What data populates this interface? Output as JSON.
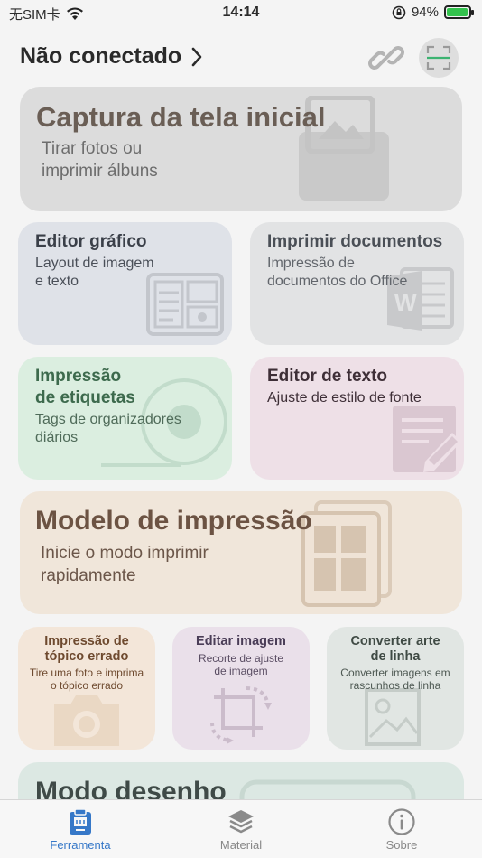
{
  "status": {
    "carrier": "无SIM卡",
    "time": "14:14",
    "battery": "94%"
  },
  "header": {
    "connection_label": "Não conectado",
    "chevron": ">"
  },
  "cards": {
    "home_capture": {
      "title": "Captura da tela inicial",
      "subtitle": "Tirar fotos ou\nimprimir álbuns"
    },
    "graphic_editor": {
      "title": "Editor gráfico",
      "subtitle": "Layout de imagem\ne texto"
    },
    "print_documents": {
      "title": "Imprimir documentos",
      "subtitle": "Impressão de\ndocumentos do Office"
    },
    "label_printing": {
      "title": "Impressão\nde etiquetas",
      "subtitle": "Tags de organizadores\ndiários"
    },
    "text_editor": {
      "title": "Editor de texto",
      "subtitle": "Ajuste de estilo de fonte"
    },
    "print_template": {
      "title": "Modelo de impressão",
      "subtitle": "Inicie o modo imprimir\nrapidamente"
    },
    "wrong_topic": {
      "title": "Impressão de\ntópico errado",
      "subtitle": "Tire uma foto e imprima\no tópico errado"
    },
    "edit_image": {
      "title": "Editar imagem",
      "subtitle": "Recorte de ajuste\nde imagem"
    },
    "line_art": {
      "title": "Converter arte\nde linha",
      "subtitle": "Converter imagens em\nrascunhos de linha"
    },
    "draw_mode": {
      "title": "Modo desenho"
    }
  },
  "tabbar": {
    "tools": "Ferramenta",
    "material": "Material",
    "about": "Sobre"
  },
  "colors": {
    "accent": "#3678c8"
  }
}
